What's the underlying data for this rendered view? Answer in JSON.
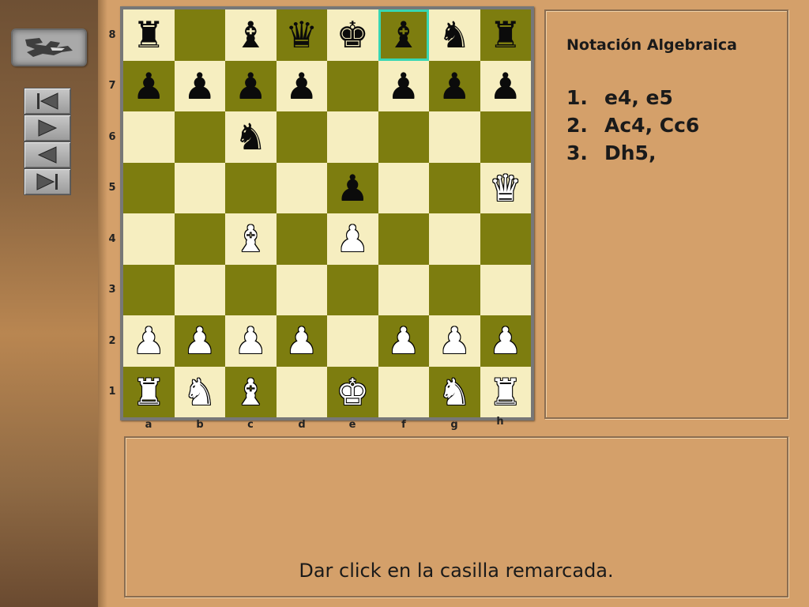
{
  "nav": {
    "first_icon": "skip-to-start-icon",
    "next_icon": "play-forward-icon",
    "prev_icon": "play-back-icon",
    "last_icon": "skip-to-end-icon"
  },
  "colors": {
    "light_square": "#f6eec0",
    "dark_square": "#7d7d0f",
    "highlight": "#37d6b3",
    "background": "#d4a06a"
  },
  "ranks": [
    "8",
    "7",
    "6",
    "5",
    "4",
    "3",
    "2",
    "1"
  ],
  "files": [
    "a",
    "b",
    "c",
    "d",
    "e",
    "f",
    "g",
    "h"
  ],
  "board": [
    [
      "bR",
      "",
      "bB",
      "bQ",
      "bK",
      "bB",
      "bN",
      "bR"
    ],
    [
      "bP",
      "bP",
      "bP",
      "bP",
      "",
      "bP",
      "bP",
      "bP"
    ],
    [
      "",
      "",
      "bN",
      "",
      "",
      "",
      "",
      ""
    ],
    [
      "",
      "",
      "",
      "",
      "bP",
      "",
      "",
      "wQ"
    ],
    [
      "",
      "",
      "wB",
      "",
      "wP",
      "",
      "",
      ""
    ],
    [
      "",
      "",
      "",
      "",
      "",
      "",
      "",
      ""
    ],
    [
      "wP",
      "wP",
      "wP",
      "wP",
      "",
      "wP",
      "wP",
      "wP"
    ],
    [
      "wR",
      "wN",
      "wB",
      "",
      "wK",
      "",
      "wN",
      "wR"
    ]
  ],
  "highlighted_square": "f8",
  "notation": {
    "title": "Notación Algebraica",
    "moves": [
      {
        "num": "1.",
        "text": "e4, e5"
      },
      {
        "num": "2.",
        "text": "Ac4, Cc6"
      },
      {
        "num": "3.",
        "text": "Dh5,"
      }
    ]
  },
  "message": "Dar click en la casilla remarcada."
}
